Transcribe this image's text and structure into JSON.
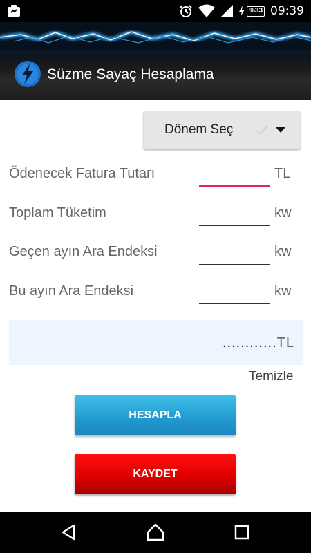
{
  "status_bar": {
    "time": "09:39",
    "battery": "%33",
    "icons": [
      "notification-icon",
      "alarm-icon",
      "wifi-icon",
      "signal-icon",
      "battery-icon"
    ]
  },
  "header": {
    "title": "Süzme Sayaç Hesaplama"
  },
  "period_button": {
    "label": "Dönem Seç"
  },
  "fields": [
    {
      "label": "Ödenecek Fatura Tutarı",
      "value": "",
      "unit": "TL"
    },
    {
      "label": "Toplam Tüketim",
      "value": "",
      "unit": "kw"
    },
    {
      "label": "Geçen ayın Ara Endeksi",
      "value": "",
      "unit": "kw"
    },
    {
      "label": "Bu ayın Ara Endeksi",
      "value": "",
      "unit": "kw"
    }
  ],
  "result": {
    "value": "............",
    "unit": "TL"
  },
  "clear_label": "Temizle",
  "calculate_label": "HESAPLA",
  "save_label": "KAYDET",
  "colors": {
    "active_underline": "#e0245e",
    "calculate_button": "#2198cf",
    "save_button": "#e00000",
    "result_background": "#eef5ff"
  }
}
